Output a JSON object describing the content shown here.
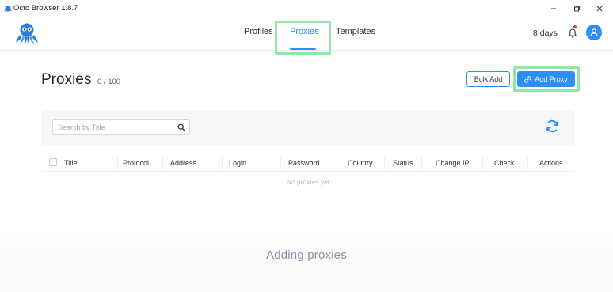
{
  "window": {
    "title": "Octo Browser 1.8.7"
  },
  "nav": {
    "tabs": [
      {
        "label": "Profiles"
      },
      {
        "label": "Proxies"
      },
      {
        "label": "Templates"
      }
    ],
    "active": "Proxies"
  },
  "header": {
    "trial_days": "8 days"
  },
  "page": {
    "title": "Proxies",
    "count": "0 / 100"
  },
  "buttons": {
    "bulk_add": "Bulk Add",
    "add_proxy": "Add Proxy"
  },
  "search": {
    "placeholder": "Search by Title",
    "value": ""
  },
  "table": {
    "columns": [
      "Title",
      "Protocol",
      "Address",
      "Login",
      "Password",
      "Country",
      "Status",
      "Change IP",
      "Check",
      "Actions"
    ],
    "empty_text": "No proxies yet"
  },
  "caption": "Adding proxies",
  "colors": {
    "accent": "#2d8ff5",
    "highlight": "#8fe6a7",
    "notification": "#ea3b3b"
  }
}
